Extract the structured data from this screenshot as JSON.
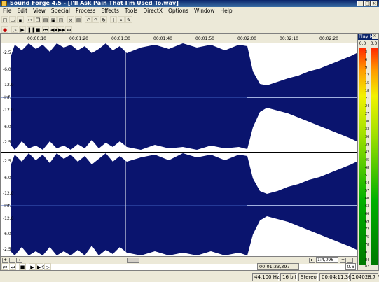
{
  "window": {
    "title": "Sound Forge 4.5 - [I'll Ask Pain That I'm Used To.wav]"
  },
  "menu": [
    {
      "label": "File"
    },
    {
      "label": "Edit"
    },
    {
      "label": "View"
    },
    {
      "label": "Special"
    },
    {
      "label": "Process"
    },
    {
      "label": "Effects"
    },
    {
      "label": "Tools"
    },
    {
      "label": "DirectX"
    },
    {
      "label": "Options"
    },
    {
      "label": "Window"
    },
    {
      "label": "Help"
    }
  ],
  "ruler": {
    "ticks": [
      "00:00:10",
      "00:01:20",
      "00:01:30",
      "00:01:40",
      "00:01:50",
      "00:02:00",
      "00:02:10",
      "00:02:20"
    ]
  },
  "db_labels": {
    "left": [
      "-2.5",
      "-6.0",
      "-12.0",
      "-Inf.",
      "-12.0",
      "-6.0",
      "-2.5"
    ],
    "right": [
      "-2.5",
      "-6.0",
      "-12.0",
      "-Inf.",
      "-12.0",
      "-6.0",
      "-2.5"
    ]
  },
  "playmeter": {
    "title": "Play M",
    "peak_left": "0.0",
    "peak_right": "0.0",
    "scale": [
      "3",
      "6",
      "9",
      "12",
      "15",
      "18",
      "21",
      "24",
      "27",
      "30",
      "33",
      "36",
      "39",
      "42",
      "45",
      "48",
      "51",
      "54",
      "57",
      "60",
      "63",
      "66",
      "69",
      "72",
      "75",
      "78",
      "81",
      "84",
      "87"
    ]
  },
  "zoom": {
    "ratio": "1:4,096",
    "level": "0.6"
  },
  "status": {
    "position": "00:01:33,397",
    "sample_rate": "44,100 Hz",
    "bit_depth": "16 bit",
    "channels": "Stereo",
    "length": "00:04:11,360",
    "disk_free": "104028,7 MB"
  },
  "colors": {
    "waveform": "#0a146e",
    "title_bar": "#0a246a"
  }
}
